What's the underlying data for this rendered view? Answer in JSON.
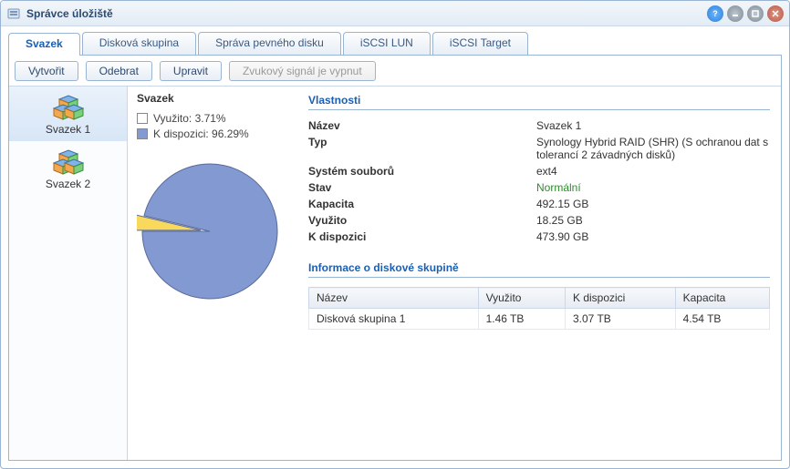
{
  "window": {
    "title": "Správce úložiště"
  },
  "tabs": [
    {
      "label": "Svazek"
    },
    {
      "label": "Disková skupina"
    },
    {
      "label": "Správa pevného disku"
    },
    {
      "label": "iSCSI LUN"
    },
    {
      "label": "iSCSI Target"
    }
  ],
  "toolbar": {
    "create": "Vytvořit",
    "remove": "Odebrat",
    "edit": "Upravit",
    "beep": "Zvukový signál je vypnut"
  },
  "sidebar": {
    "items": [
      {
        "label": "Svazek 1"
      },
      {
        "label": "Svazek 2"
      }
    ]
  },
  "volume": {
    "title": "Svazek",
    "legend_used": "Využito: 3.71%",
    "legend_avail": "K dispozici: 96.29%"
  },
  "props": {
    "header": "Vlastnosti",
    "name_k": "Název",
    "name_v": "Svazek 1",
    "type_k": "Typ",
    "type_v": "Synology Hybrid RAID (SHR) (S ochranou dat s tolerancí 2 závadných disků)",
    "fs_k": "Systém souborů",
    "fs_v": "ext4",
    "status_k": "Stav",
    "status_v": "Normální",
    "cap_k": "Kapacita",
    "cap_v": "492.15 GB",
    "used_k": "Využito",
    "used_v": "18.25 GB",
    "avail_k": "K dispozici",
    "avail_v": "473.90 GB"
  },
  "dg": {
    "header": "Informace o diskové skupině",
    "cols": {
      "name": "Název",
      "used": "Využito",
      "avail": "K dispozici",
      "cap": "Kapacita"
    },
    "row": {
      "name": "Disková skupina 1",
      "used": "1.46 TB",
      "avail": "3.07 TB",
      "cap": "4.54 TB"
    }
  },
  "colors": {
    "used": "#f8d95b",
    "avail": "#8399d2"
  },
  "chart_data": {
    "type": "pie",
    "title": "",
    "series": [
      {
        "name": "Využito",
        "value": 3.71,
        "color": "#f8d95b"
      },
      {
        "name": "K dispozici",
        "value": 96.29,
        "color": "#8399d2"
      }
    ]
  }
}
